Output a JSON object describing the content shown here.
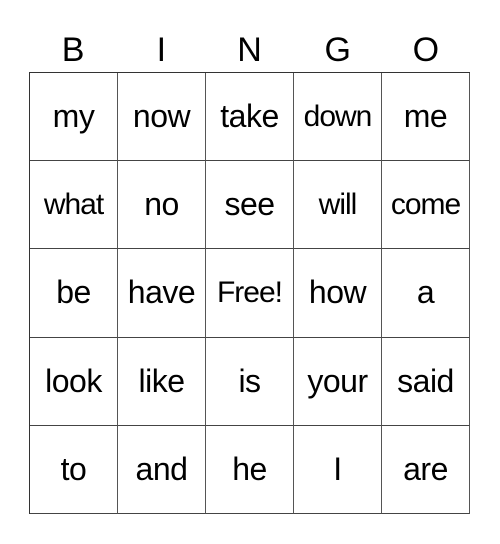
{
  "header": {
    "letters": [
      "B",
      "I",
      "N",
      "G",
      "O"
    ]
  },
  "board": {
    "rows": [
      [
        "my",
        "now",
        "take",
        "down",
        "me"
      ],
      [
        "what",
        "no",
        "see",
        "will",
        "come"
      ],
      [
        "be",
        "have",
        "Free!",
        "how",
        "a"
      ],
      [
        "look",
        "like",
        "is",
        "your",
        "said"
      ],
      [
        "to",
        "and",
        "he",
        "I",
        "are"
      ]
    ]
  }
}
